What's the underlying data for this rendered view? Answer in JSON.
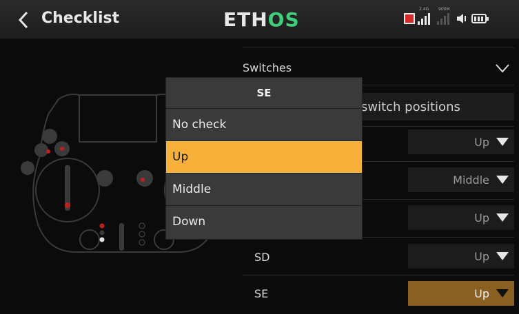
{
  "header": {
    "title": "Checklist",
    "logo_main": "ETH",
    "logo_accent": "OS",
    "rf_band_1": "2.4G",
    "rf_band_2": "900M"
  },
  "settings": {
    "switches_label": "Switches",
    "switch_positions_button": "switch positions",
    "rows": [
      {
        "label": "",
        "value": "Up"
      },
      {
        "label": "",
        "value": "Middle"
      },
      {
        "label": "",
        "value": "Up"
      },
      {
        "label": "SD",
        "value": "Up"
      },
      {
        "label": "SE",
        "value": "Up"
      }
    ]
  },
  "popup": {
    "title": "SE",
    "options": [
      "No check",
      "Up",
      "Middle",
      "Down"
    ],
    "selected": "Up"
  },
  "colors": {
    "accent": "#f7b13a",
    "active_row": "#8a6022",
    "logo_green": "#3fcf7a",
    "alert_red": "#d52b2b"
  }
}
